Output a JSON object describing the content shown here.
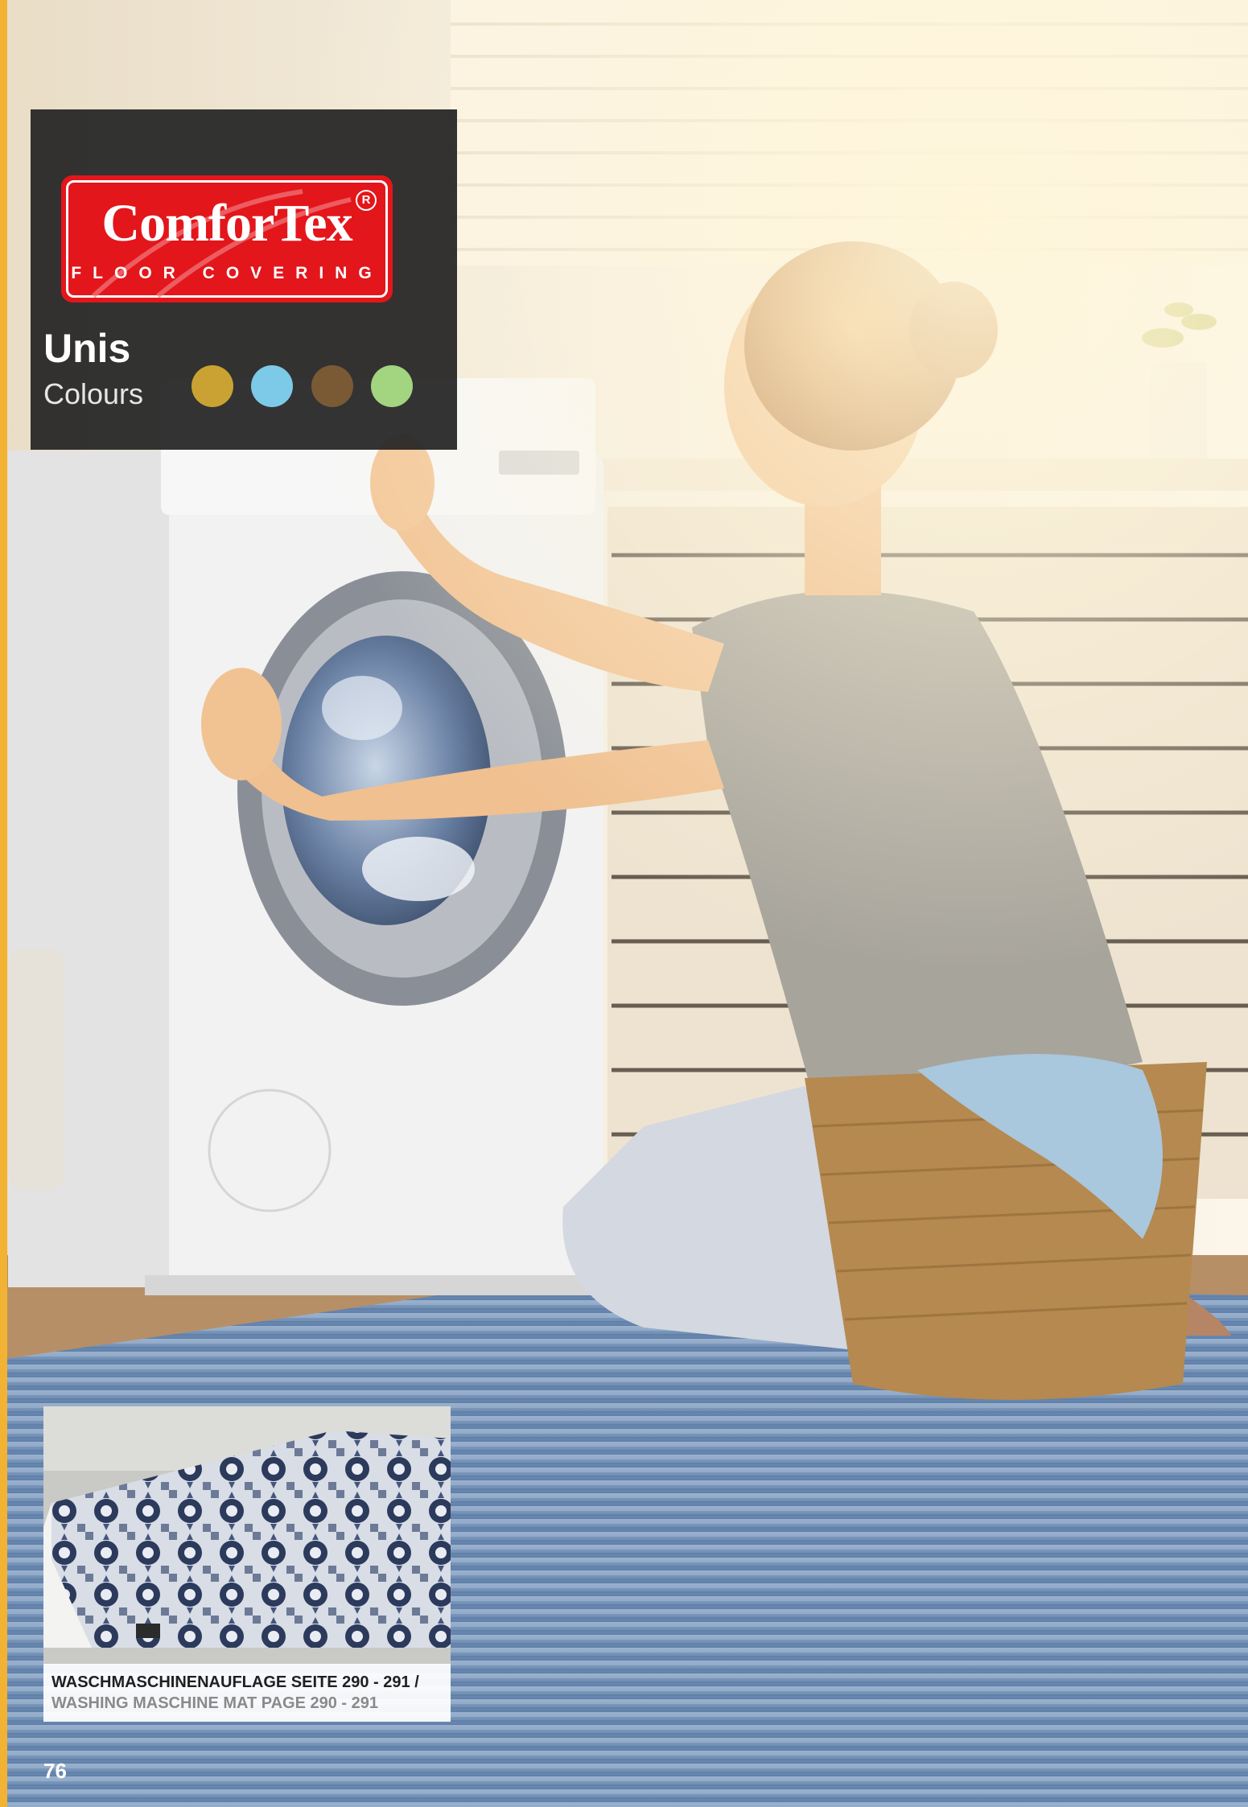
{
  "brand": {
    "name": "ComforTex",
    "tagline": "FLOOR COVERING",
    "registered_mark": "R",
    "colors": {
      "logo_red": "#e3161b",
      "panel": "#262626",
      "accent_bar": "#f2b233"
    }
  },
  "range": {
    "title": "Unis",
    "subtitle": "Colours",
    "swatches": [
      "#c9a233",
      "#7dc9e8",
      "#7a5a35",
      "#a3d480"
    ]
  },
  "inset": {
    "caption_de": "WASCHMASCHINENAUFLAGE SEITE 290 - 291 /",
    "caption_en": "WASHING MASCHINE MAT PAGE 290 - 291"
  },
  "page_number": "76"
}
